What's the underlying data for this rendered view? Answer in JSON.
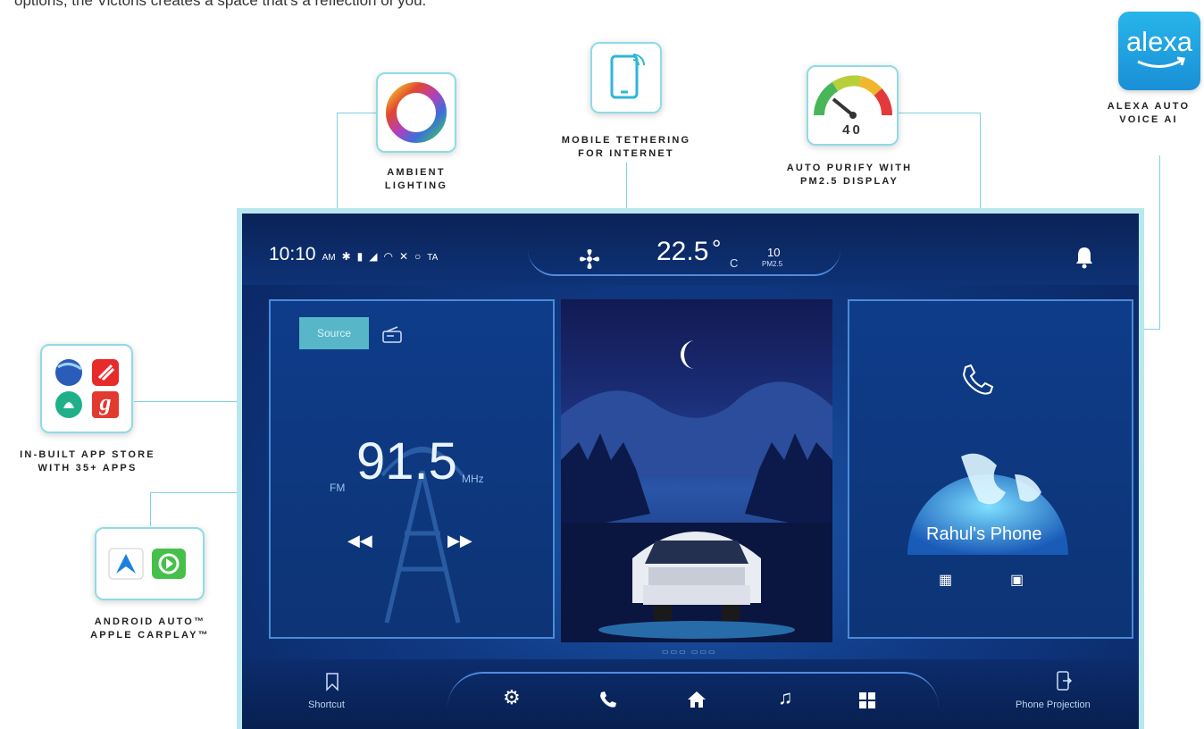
{
  "intro": "options, the Victoris creates a space that's a reflection of you.",
  "features": {
    "ambient": [
      "AMBIENT",
      "LIGHTING"
    ],
    "tethering": [
      "MOBILE TETHERING",
      "FOR INTERNET"
    ],
    "purify": [
      "AUTO PURIFY WITH",
      "PM2.5 DISPLAY"
    ],
    "purify_value": "40",
    "alexa": [
      "ALEXA AUTO",
      "VOICE AI"
    ],
    "alexa_logo": "alexa",
    "appstore": [
      "IN-BUILT APP STORE",
      "WITH 35+ APPS"
    ],
    "appstore_gaana": "g",
    "carplay": [
      "ANDROID AUTO™",
      "APPLE CARPLAY™"
    ]
  },
  "status": {
    "time": "10:10",
    "ampm": "AM",
    "ta": "TA",
    "temperature": "22.5",
    "temp_degree": "°",
    "temp_unit": "C",
    "pm_value": "10",
    "pm_label": "PM2.5"
  },
  "radio": {
    "source_label": "Source",
    "band": "FM",
    "frequency": "91.5",
    "unit": "MHz"
  },
  "phone": {
    "device": "Rahul's Phone"
  },
  "nav": {
    "shortcut": "Shortcut",
    "projection": "Phone Projection"
  },
  "colors": {
    "accent": "#8fdbe6",
    "screen_bg": "#103a84"
  }
}
